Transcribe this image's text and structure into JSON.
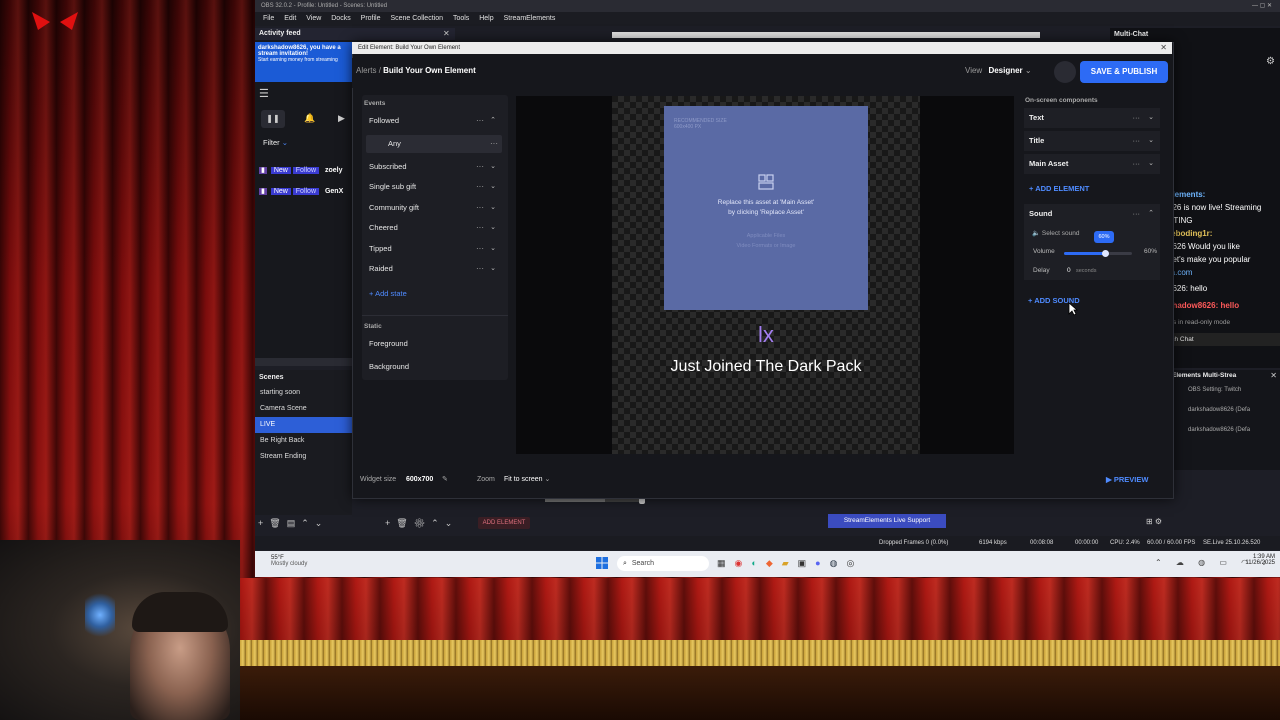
{
  "obs": {
    "title": "OBS 32.0.2 - Profile: Untitled - Scenes: Untitled",
    "menu": [
      "File",
      "Edit",
      "View",
      "Docks",
      "Profile",
      "Scene Collection",
      "Tools",
      "Help",
      "StreamElements"
    ],
    "activity_feed": {
      "title": "Activity feed",
      "promo_line1": "darkshadow8626, you have a",
      "promo_line2": "stream invitation!",
      "promo_line3": "Start earning money from streaming",
      "filter": "Filter",
      "items": [
        {
          "badge": "New",
          "type": "Follow",
          "user": "zoely"
        },
        {
          "badge": "New",
          "type": "Follow",
          "user": "GenX"
        }
      ]
    },
    "scenes": {
      "title": "Scenes",
      "items": [
        "starting soon",
        "Camera Scene",
        "LIVE",
        "Be Right Back",
        "Stream Ending"
      ],
      "active": "LIVE"
    },
    "multichat": {
      "title": "Multi-Chat",
      "lines": [
        {
          "text": "elements:",
          "color": "#6fb6ff"
        },
        {
          "text": "626 is now live! Streaming",
          "color": "#ffffff"
        },
        {
          "text": "STING",
          "color": "#ffffff"
        },
        {
          "text": "reboding1r:",
          "color": "#e2c25a"
        },
        {
          "text": "8626 Would you like",
          "color": "#ffffff"
        },
        {
          "text": "Let's make you popular",
          "color": "#ffffff"
        },
        {
          "text": "ra.com",
          "color": "#6fb6ff"
        },
        {
          "text": "8626: hello",
          "color": "#ffffff"
        },
        {
          "text": "shadow8626: hello",
          "color": "#ff5a5a"
        }
      ],
      "readonly": "t is in read-only mode",
      "twitch_chat": "itch Chat"
    },
    "multistream": {
      "title": "Elements Multi-Strea",
      "rows": [
        {
          "name": "OBS Setting: Twitch"
        },
        {
          "name": "darkshadow8626 (Defa"
        },
        {
          "name": "darkshadow8626 (Defa"
        }
      ]
    },
    "support_button": "StreamElements Live Support",
    "add_element_button": "ADD ELEMENT",
    "status": {
      "dropped": "Dropped Frames 0 (0.0%)",
      "bitrate": "6194 kbps",
      "time_live": "00:08:08",
      "time_rec": "00:00:00",
      "cpu": "CPU: 2.4%",
      "fps": "60.00 / 60.00 FPS",
      "version": "SE.Live 25.10.26.520"
    }
  },
  "taskbar": {
    "weather_temp": "55°F",
    "weather_desc": "Mostly cloudy",
    "search": "Search",
    "time": "1:39 AM",
    "date": "11/26/2025"
  },
  "modal": {
    "window_title": "Edit Element: Build Your Own Element",
    "breadcrumb_parent": "Alerts",
    "breadcrumb_current": "Build Your Own Element",
    "view_label": "View",
    "view_value": "Designer",
    "save_button": "SAVE & PUBLISH",
    "events": {
      "heading": "Events",
      "items": [
        {
          "label": "Followed"
        },
        {
          "label": "Any"
        },
        {
          "label": "Subscribed"
        },
        {
          "label": "Single sub gift"
        },
        {
          "label": "Community gift"
        },
        {
          "label": "Cheered"
        },
        {
          "label": "Tipped"
        },
        {
          "label": "Raided"
        }
      ],
      "add_state": "Add state",
      "static_heading": "Static",
      "static_items": [
        "Foreground",
        "Background"
      ]
    },
    "canvas": {
      "recommended_line1": "RECOMMENDED SIZE",
      "recommended_line2": "600x400 PX",
      "replace_line1": "Replace this asset at 'Main Asset'",
      "replace_line2": "by clicking 'Replace Asset'",
      "applicable_line1": "Applicable Files",
      "applicable_line2": "Video Formats or Image",
      "name_text": "lx",
      "message_text": "Just Joined The Dark Pack"
    },
    "components": {
      "heading": "On-screen components",
      "items": [
        "Text",
        "Title",
        "Main Asset"
      ],
      "add_element": "ADD ELEMENT",
      "sound": {
        "label": "Sound",
        "select_sound": "Select sound",
        "volume_label": "Volume",
        "volume_value": "60%",
        "volume_fraction": 0.6,
        "tooltip": "60%",
        "delay_label": "Delay",
        "delay_value": "0",
        "delay_unit": "seconds"
      },
      "add_sound": "ADD SOUND"
    },
    "footer": {
      "widget_size_label": "Widget size",
      "widget_size_value": "600x700",
      "zoom_label": "Zoom",
      "zoom_value": "Fit to screen",
      "preview_button": "PREVIEW"
    }
  }
}
